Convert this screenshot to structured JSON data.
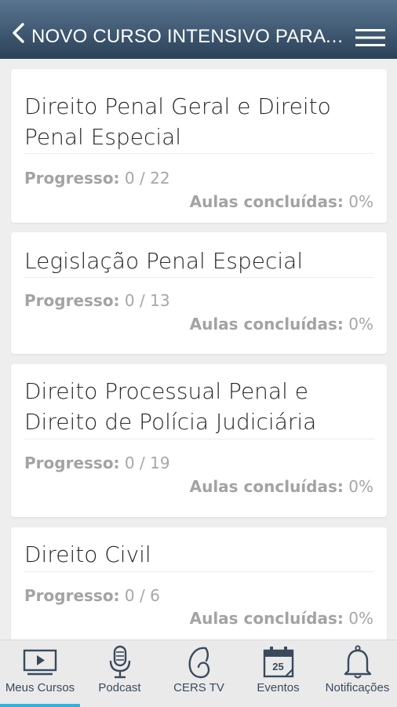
{
  "header": {
    "title": "NOVO CURSO INTENSIVO PARA DELEGADO DE POLÍCIA CIVIL"
  },
  "courses": [
    {
      "title": "Direito Penal Geral e Direito Penal Especial",
      "progress_label": "Progresso:",
      "progress_value": "0 / 22",
      "done_label": "Aulas concluídas:",
      "done_value": "0%"
    },
    {
      "title": "Legislação Penal Especial",
      "progress_label": "Progresso:",
      "progress_value": "0 / 13",
      "done_label": "Aulas concluídas:",
      "done_value": "0%"
    },
    {
      "title": "Direito Processual Penal e Direito de Polícia Judiciária",
      "progress_label": "Progresso:",
      "progress_value": "0 / 19",
      "done_label": "Aulas concluídas:",
      "done_value": "0%"
    },
    {
      "title": "Direito Civil",
      "progress_label": "Progresso:",
      "progress_value": "0 / 6",
      "done_label": "Aulas concluídas:",
      "done_value": "0%"
    }
  ],
  "tabs": [
    {
      "label": "Meus Cursos",
      "icon": "video-player-icon",
      "active": true
    },
    {
      "label": "Podcast",
      "icon": "microphone-icon",
      "active": false
    },
    {
      "label": "CERS TV",
      "icon": "cers-tv-icon",
      "active": false
    },
    {
      "label": "Eventos",
      "icon": "calendar-icon",
      "calendar_day": "25",
      "active": false
    },
    {
      "label": "Notificações",
      "icon": "bell-icon",
      "active": false
    }
  ],
  "colors": {
    "header_top": "#5a7591",
    "header_bottom": "#2a4258",
    "accent": "#3aaed8",
    "muted_text": "#a6a6a6"
  }
}
